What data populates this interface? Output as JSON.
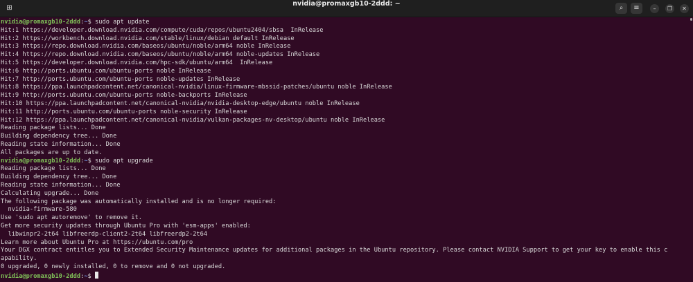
{
  "window": {
    "title": "nvidia@promaxgb10-2ddd: ~",
    "buttons": {
      "new_tab": "⊞",
      "search": "⌕",
      "menu": "≡",
      "minimize": "–",
      "restore": "❐",
      "close": "✕"
    }
  },
  "prompt": {
    "user_host": "nvidia@promaxgb10-2ddd",
    "path": "~",
    "symbol": "$"
  },
  "lines": [
    {
      "type": "prompt",
      "cmd": " sudo apt update"
    },
    {
      "type": "out",
      "text": "Hit:1 https://developer.download.nvidia.com/compute/cuda/repos/ubuntu2404/sbsa  InRelease"
    },
    {
      "type": "out",
      "text": "Hit:2 https://workbench.download.nvidia.com/stable/linux/debian default InRelease"
    },
    {
      "type": "out",
      "text": "Hit:3 https://repo.download.nvidia.com/baseos/ubuntu/noble/arm64 noble InRelease"
    },
    {
      "type": "out",
      "text": "Hit:4 https://repo.download.nvidia.com/baseos/ubuntu/noble/arm64 noble-updates InRelease"
    },
    {
      "type": "out",
      "text": "Hit:5 https://developer.download.nvidia.com/hpc-sdk/ubuntu/arm64  InRelease"
    },
    {
      "type": "out",
      "text": "Hit:6 http://ports.ubuntu.com/ubuntu-ports noble InRelease"
    },
    {
      "type": "out",
      "text": "Hit:7 http://ports.ubuntu.com/ubuntu-ports noble-updates InRelease"
    },
    {
      "type": "out",
      "text": "Hit:8 https://ppa.launchpadcontent.net/canonical-nvidia/linux-firmware-mbssid-patches/ubuntu noble InRelease"
    },
    {
      "type": "out",
      "text": "Hit:9 http://ports.ubuntu.com/ubuntu-ports noble-backports InRelease"
    },
    {
      "type": "out",
      "text": "Hit:10 https://ppa.launchpadcontent.net/canonical-nvidia/nvidia-desktop-edge/ubuntu noble InRelease"
    },
    {
      "type": "out",
      "text": "Hit:11 http://ports.ubuntu.com/ubuntu-ports noble-security InRelease"
    },
    {
      "type": "out",
      "text": "Hit:12 https://ppa.launchpadcontent.net/canonical-nvidia/vulkan-packages-nv-desktop/ubuntu noble InRelease"
    },
    {
      "type": "out",
      "text": "Reading package lists... Done"
    },
    {
      "type": "out",
      "text": "Building dependency tree... Done"
    },
    {
      "type": "out",
      "text": "Reading state information... Done"
    },
    {
      "type": "out",
      "text": "All packages are up to date."
    },
    {
      "type": "prompt",
      "cmd": " sudo apt upgrade"
    },
    {
      "type": "out",
      "text": "Reading package lists... Done"
    },
    {
      "type": "out",
      "text": "Building dependency tree... Done"
    },
    {
      "type": "out",
      "text": "Reading state information... Done"
    },
    {
      "type": "out",
      "text": "Calculating upgrade... Done"
    },
    {
      "type": "out",
      "text": "The following package was automatically installed and is no longer required:"
    },
    {
      "type": "out",
      "text": "  nvidia-firmware-580"
    },
    {
      "type": "out",
      "text": "Use 'sudo apt autoremove' to remove it."
    },
    {
      "type": "out",
      "text": "Get more security updates through Ubuntu Pro with 'esm-apps' enabled:"
    },
    {
      "type": "out",
      "text": "  libwinpr2-2t64 libfreerdp-client2-2t64 libfreerdp2-2t64"
    },
    {
      "type": "out",
      "text": "Learn more about Ubuntu Pro at https://ubuntu.com/pro"
    },
    {
      "type": "out",
      "text": "Your DGX contract entitles you to Extended Security Maintenance updates for additional packages in the Ubuntu repository. Please contact NVIDIA Support to get your key to enable this c"
    },
    {
      "type": "out",
      "text": "apability."
    },
    {
      "type": "out",
      "text": "0 upgraded, 0 newly installed, 0 to remove and 0 not upgraded."
    },
    {
      "type": "prompt",
      "cmd": " ",
      "cursor": true
    }
  ]
}
